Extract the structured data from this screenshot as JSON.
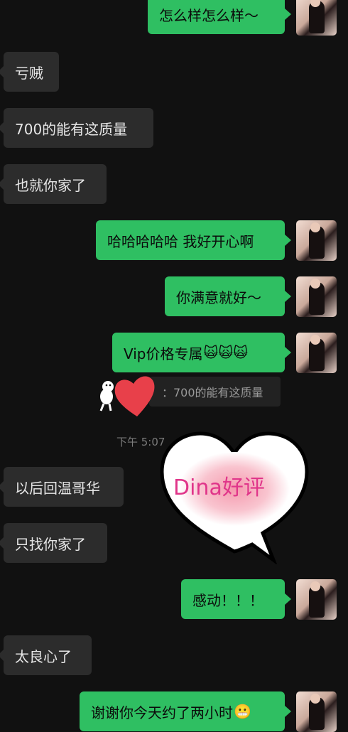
{
  "messages": [
    {
      "side": "out",
      "text": "怎么样怎么样～"
    },
    {
      "side": "in",
      "text": "亏贼"
    },
    {
      "side": "in",
      "text": "700的能有这质量"
    },
    {
      "side": "in",
      "text": "也就你家了"
    },
    {
      "side": "out",
      "text": "哈哈哈哈哈 我好开心啊"
    },
    {
      "side": "out",
      "text": "你满意就好～"
    },
    {
      "side": "out",
      "text": "Vip价格专属"
    },
    {
      "side": "in",
      "text": "以后回温哥华"
    },
    {
      "side": "in",
      "text": "只找你家了"
    },
    {
      "side": "out",
      "text": "感动！！！"
    },
    {
      "side": "in",
      "text": "太良心了"
    },
    {
      "side": "out",
      "text": "谢谢你今天约了两小时"
    }
  ],
  "emoji": {
    "cat_faces": "🙀🙀🙀",
    "grin": "😬"
  },
  "quote_text": "：700的能有这质量",
  "timestamp": "下午 5:07",
  "sticker_text": "Dina好评",
  "colors": {
    "background": "#111111",
    "outgoing_bubble": "#2fbf62",
    "incoming_bubble": "#2c2c2c"
  }
}
